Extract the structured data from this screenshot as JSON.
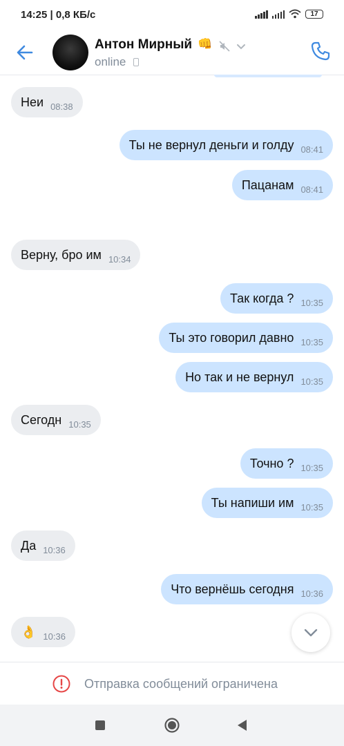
{
  "statusbar": {
    "time_info": "14:25 | 0,8 КБ/с",
    "battery": "17"
  },
  "header": {
    "name": "Антон Мирный",
    "badge": "👊",
    "status": "online"
  },
  "messages": [
    {
      "dir": "in",
      "text": "Неи",
      "time": "08:38"
    },
    {
      "dir": "out",
      "text": "Ты не вернул деньги и голду",
      "time": "08:41"
    },
    {
      "dir": "out",
      "text": "Пацанам",
      "time": "08:41"
    },
    {
      "dir": "in",
      "text": "Верну, бро им",
      "time": "10:34"
    },
    {
      "dir": "out",
      "text": "Так когда ?",
      "time": "10:35"
    },
    {
      "dir": "out",
      "text": "Ты это говорил давно",
      "time": "10:35"
    },
    {
      "dir": "out",
      "text": "Но так и не вернул",
      "time": "10:35"
    },
    {
      "dir": "in",
      "text": "Сегодн",
      "time": "10:35"
    },
    {
      "dir": "out",
      "text": "Точно ?",
      "time": "10:35"
    },
    {
      "dir": "out",
      "text": "Ты напиши им",
      "time": "10:35"
    },
    {
      "dir": "in",
      "text": "Да",
      "time": "10:36"
    },
    {
      "dir": "out",
      "text": "Что вернёшь сегодня",
      "time": "10:36"
    },
    {
      "dir": "in",
      "text": "👌",
      "time": "10:36"
    }
  ],
  "footer": {
    "restriction_text": "Отправка сообщений ограничена"
  },
  "colors": {
    "accent": "#3f8ae0",
    "incoming": "#ebedf0",
    "outgoing": "#cce4ff",
    "warning": "#e64646"
  }
}
